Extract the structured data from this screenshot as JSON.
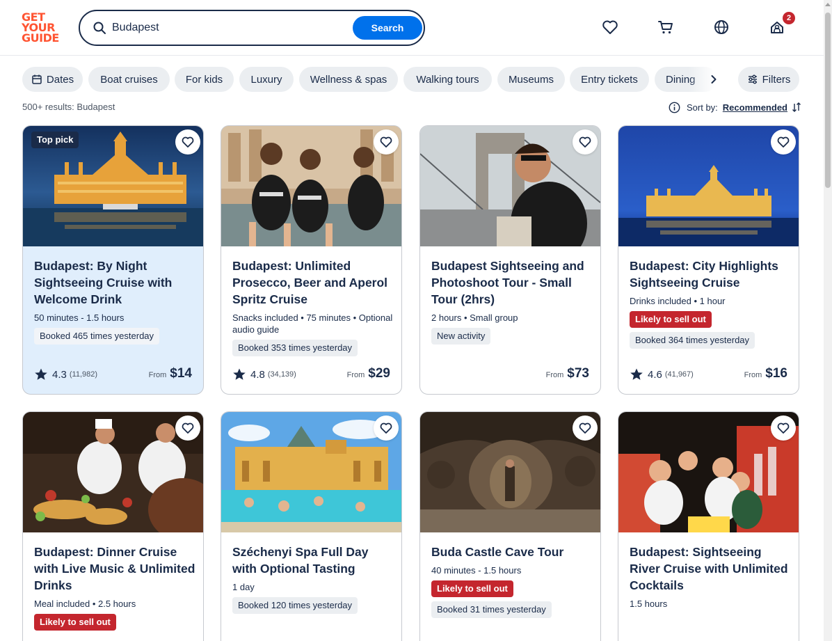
{
  "logo": {
    "line1": "GET",
    "line2": "YOUR",
    "line3": "GUIDE"
  },
  "search": {
    "value": "Budapest",
    "placeholder": "",
    "button_label": "Search"
  },
  "header": {
    "cart_badge": "2"
  },
  "chips": [
    "Dates",
    "Boat cruises",
    "For kids",
    "Luxury",
    "Wellness & spas",
    "Walking tours",
    "Museums",
    "Entry tickets",
    "Dining"
  ],
  "filters_label": "Filters",
  "results": {
    "count_label": "500+ results: Budapest"
  },
  "sort": {
    "label": "Sort by:",
    "value": "Recommended"
  },
  "cards": [
    {
      "title": "Budapest: By Night Sightseeing Cruise with Welcome Drink",
      "meta": "50 minutes - 1.5 hours",
      "booked": "Booked 465 times yesterday",
      "rating": "4.3",
      "reviews": "(11,982)",
      "from": "From",
      "price": "$14",
      "top_pick": "Top pick"
    },
    {
      "title": "Budapest: Unlimited Prosecco, Beer and Aperol Spritz Cruise",
      "meta": "Snacks included • 75 minutes • Optional audio guide",
      "booked": "Booked 353 times yesterday",
      "rating": "4.8",
      "reviews": "(34,139)",
      "from": "From",
      "price": "$29"
    },
    {
      "title": "Budapest Sightseeing and Photoshoot Tour - Small Tour (2hrs)",
      "meta": "2 hours • Small group",
      "new_label": "New activity",
      "from": "From",
      "price": "$73"
    },
    {
      "title": "Budapest: City Highlights Sightseeing Cruise",
      "meta": "Drinks included • 1 hour",
      "sellout": "Likely to sell out",
      "booked": "Booked 364 times yesterday",
      "rating": "4.6",
      "reviews": "(41,967)",
      "from": "From",
      "price": "$16"
    },
    {
      "title": "Budapest: Dinner Cruise with Live Music & Unlimited Drinks",
      "meta": "Meal included • 2.5 hours",
      "sellout": "Likely to sell out"
    },
    {
      "title": "Széchenyi Spa Full Day with Optional Tasting",
      "meta": "1 day",
      "booked": "Booked 120 times yesterday"
    },
    {
      "title": "Buda Castle Cave Tour",
      "meta": "40 minutes - 1.5 hours",
      "sellout": "Likely to sell out",
      "booked": "Booked 31 times yesterday"
    },
    {
      "title": "Budapest: Sightseeing River Cruise with Unlimited Cocktails",
      "meta": "1.5 hours"
    }
  ]
}
